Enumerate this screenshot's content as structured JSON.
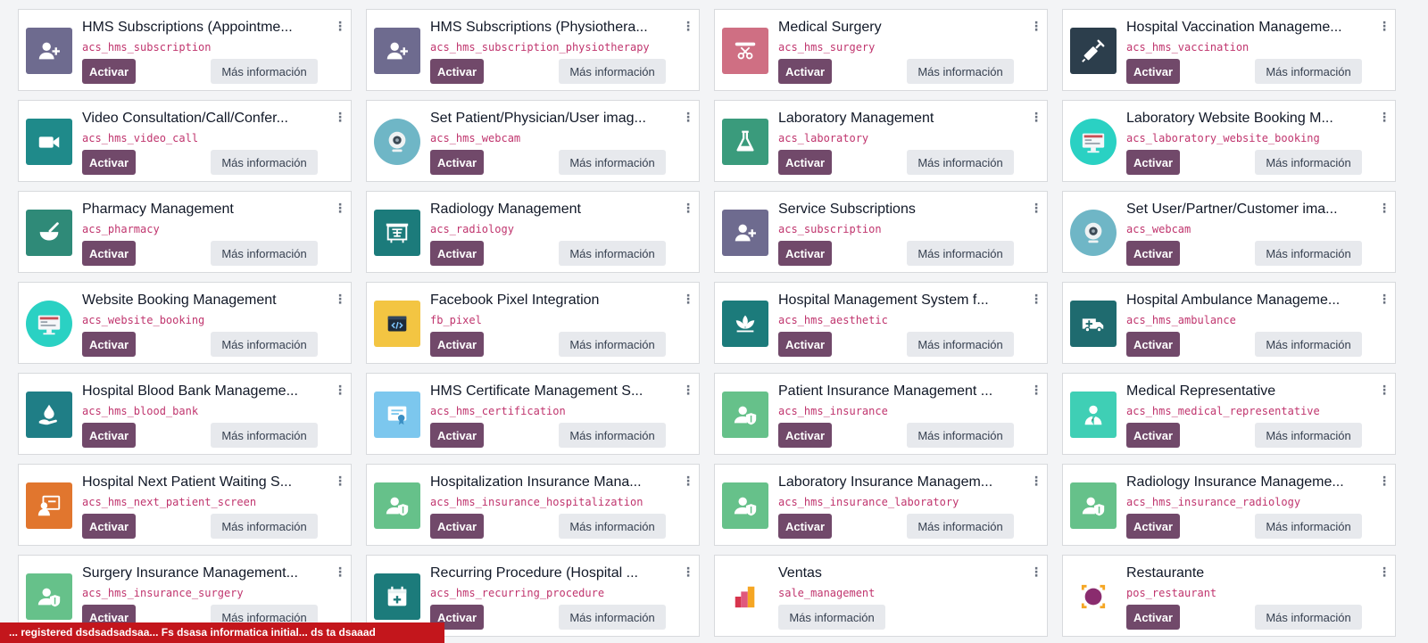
{
  "modules": [
    {
      "title": "HMS Subscriptions (Appointme...",
      "tech": "acs_hms_subscription",
      "icon": "user-plus-icon",
      "bg": "#6e6b8f",
      "activate": true
    },
    {
      "title": "HMS Subscriptions (Physiothera...",
      "tech": "acs_hms_subscription_physiotherapy",
      "icon": "user-plus-icon",
      "bg": "#6e6b8f",
      "activate": true
    },
    {
      "title": "Medical Surgery",
      "tech": "acs_hms_surgery",
      "icon": "surgery-icon",
      "bg": "#cf6f83",
      "activate": true
    },
    {
      "title": "Hospital Vaccination Manageme...",
      "tech": "acs_hms_vaccination",
      "icon": "syringe-icon",
      "bg": "#2c3e4c",
      "activate": true
    },
    {
      "title": "Video Consultation/Call/Confer...",
      "tech": "acs_hms_video_call",
      "icon": "video-camera-icon",
      "bg": "#1f8a8a",
      "activate": true
    },
    {
      "title": "Set Patient/Physician/User imag...",
      "tech": "acs_hms_webcam",
      "icon": "webcam-icon",
      "bg": "#6fb6c6",
      "activate": true,
      "round": true
    },
    {
      "title": "Laboratory Management",
      "tech": "acs_laboratory",
      "icon": "flask-icon",
      "bg": "#3a9b7c",
      "activate": true
    },
    {
      "title": "Laboratory Website Booking M...",
      "tech": "acs_laboratory_website_booking",
      "icon": "monitor-booking-icon",
      "bg": "#2ad1c3",
      "activate": true,
      "round": true
    },
    {
      "title": "Pharmacy Management",
      "tech": "acs_pharmacy",
      "icon": "mortar-pestle-icon",
      "bg": "#2f8a78",
      "activate": true
    },
    {
      "title": "Radiology Management",
      "tech": "acs_radiology",
      "icon": "xray-board-icon",
      "bg": "#1c7b7b",
      "activate": true
    },
    {
      "title": "Service Subscriptions",
      "tech": "acs_subscription",
      "icon": "user-plus-icon",
      "bg": "#6e6b8f",
      "activate": true
    },
    {
      "title": "Set User/Partner/Customer ima...",
      "tech": "acs_webcam",
      "icon": "webcam-icon",
      "bg": "#6fb6c6",
      "activate": true,
      "round": true
    },
    {
      "title": "Website Booking Management",
      "tech": "acs_website_booking",
      "icon": "monitor-booking-icon",
      "bg": "#2ad1c3",
      "activate": true,
      "round": true
    },
    {
      "title": "Facebook Pixel Integration",
      "tech": "fb_pixel",
      "icon": "code-window-icon",
      "bg": "#f3c542",
      "activate": true
    },
    {
      "title": "Hospital Management System f...",
      "tech": "acs_hms_aesthetic",
      "icon": "lotus-icon",
      "bg": "#1c7b7b",
      "activate": true
    },
    {
      "title": "Hospital Ambulance Manageme...",
      "tech": "acs_hms_ambulance",
      "icon": "ambulance-icon",
      "bg": "#1f6b6f",
      "activate": true
    },
    {
      "title": "Hospital Blood Bank Manageme...",
      "tech": "acs_hms_blood_bank",
      "icon": "blood-drop-hand-icon",
      "bg": "#1f7e86",
      "activate": true
    },
    {
      "title": "HMS Certificate Management S...",
      "tech": "acs_hms_certification",
      "icon": "certificate-icon",
      "bg": "#7cc7ee",
      "activate": true
    },
    {
      "title": "Patient Insurance Management ...",
      "tech": "acs_hms_insurance",
      "icon": "user-shield-icon",
      "bg": "#66c18a",
      "activate": true
    },
    {
      "title": "Medical Representative",
      "tech": "acs_hms_medical_representative",
      "icon": "representative-icon",
      "bg": "#3fcfb5",
      "activate": true
    },
    {
      "title": "Hospital Next Patient Waiting S...",
      "tech": "acs_hms_next_patient_screen",
      "icon": "waiting-screen-icon",
      "bg": "#e1762e",
      "activate": true
    },
    {
      "title": "Hospitalization Insurance Mana...",
      "tech": "acs_hms_insurance_hospitalization",
      "icon": "user-shield-icon",
      "bg": "#66c18a",
      "activate": true
    },
    {
      "title": "Laboratory Insurance Managem...",
      "tech": "acs_hms_insurance_laboratory",
      "icon": "user-shield-icon",
      "bg": "#66c18a",
      "activate": true
    },
    {
      "title": "Radiology Insurance Manageme...",
      "tech": "acs_hms_insurance_radiology",
      "icon": "user-shield-icon",
      "bg": "#66c18a",
      "activate": true
    },
    {
      "title": "Surgery Insurance Management...",
      "tech": "acs_hms_insurance_surgery",
      "icon": "user-shield-icon",
      "bg": "#66c18a",
      "activate": true
    },
    {
      "title": "Recurring Procedure (Hospital ...",
      "tech": "acs_hms_recurring_procedure",
      "icon": "calendar-plus-icon",
      "bg": "#1c7b7b",
      "activate": true
    },
    {
      "title": "Ventas",
      "tech": "sale_management",
      "icon": "sales-chart-icon",
      "bg": "#ffffff",
      "activate": false
    },
    {
      "title": "Restaurante",
      "tech": "pos_restaurant",
      "icon": "restaurant-icon",
      "bg": "#ffffff",
      "activate": true
    }
  ],
  "labels": {
    "activate": "Activar",
    "more_info": "Más información",
    "kebab": "⋮"
  },
  "banner": {
    "text": "... registered dsdsadsadsaa... Fs dsasa informatica initial... ds ta dsaaad"
  },
  "colors": {
    "primary": "#71496a",
    "tech_name": "#c0356e",
    "secondary_btn": "#e7e9ed",
    "banner": "#c3161c"
  }
}
